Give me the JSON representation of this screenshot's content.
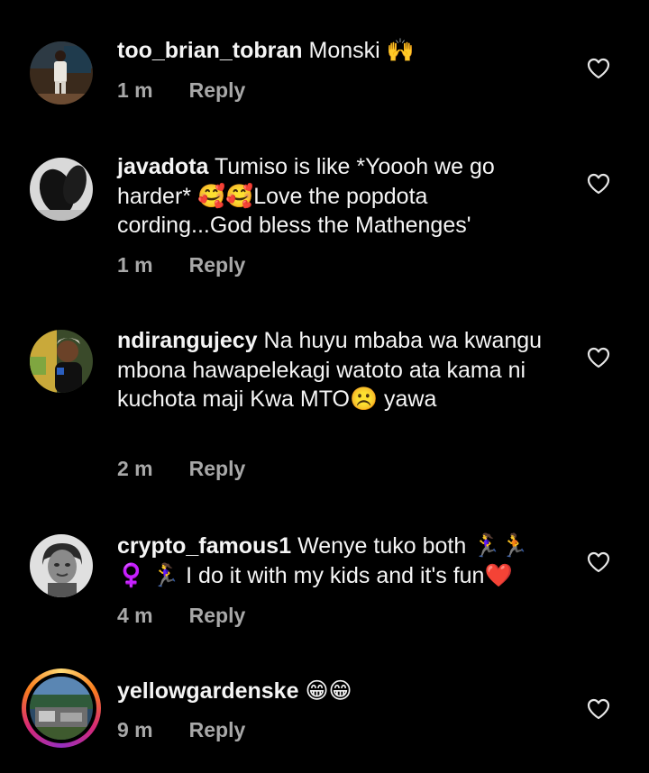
{
  "comments": [
    {
      "username": "too_brian_tobran",
      "text": "Monski 🙌",
      "time": "1 m",
      "reply_label": "Reply",
      "avatar": "man-standing-photo",
      "story_ring": false
    },
    {
      "username": "javadota",
      "text": "Tumiso is like *Yoooh we go harder* 🥰🥰Love the popdota cording...God bless the Mathenges'",
      "time": "1 m",
      "reply_label": "Reply",
      "avatar": "black-shoes-photo",
      "story_ring": false
    },
    {
      "username": "ndirangujecy",
      "text": "Na huyu mbaba wa kwangu mbona hawapelekagi watoto ata kama ni kuchota maji Kwa MTO☹️ yawa",
      "time": "2 m",
      "reply_label": "Reply",
      "avatar": "woman-photo",
      "story_ring": false
    },
    {
      "username": "crypto_famous1",
      "text": "Wenye tuko both 🏃‍♀️🏃 ♀️ 🏃‍♀️ I do it with my kids and it's fun❤️",
      "time": "4 m",
      "reply_label": "Reply",
      "avatar": "grayscale-portrait-photo",
      "story_ring": false
    },
    {
      "username": "yellowgardenske",
      "text": "😁😁",
      "time": "9 m",
      "reply_label": "Reply",
      "avatar": "garden-photo",
      "story_ring": true
    }
  ]
}
